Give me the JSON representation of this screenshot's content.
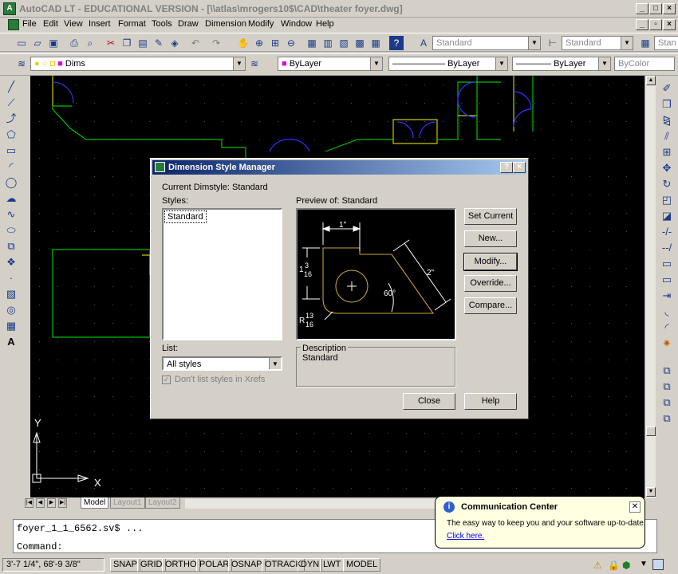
{
  "window": {
    "title": "AutoCAD LT - EDUCATIONAL VERSION - [\\\\atlas\\mrogers10$\\CAD\\theater foyer.dwg]",
    "min": "_",
    "max": "□",
    "close": "×"
  },
  "menu": [
    "File",
    "Edit",
    "View",
    "Insert",
    "Format",
    "Tools",
    "Draw",
    "Dimension",
    "Modify",
    "Window",
    "Help"
  ],
  "toolbar": {
    "text_style": "Standard",
    "dim_style": "Standard",
    "table_style": "Stan",
    "layer": "Dims",
    "color": "ByLayer",
    "linetype": "ByLayer",
    "lineweight": "ByLayer",
    "plotstyle": "ByColor"
  },
  "canvas": {
    "ucs_y": "Y",
    "ucs_x": "X"
  },
  "layout_tabs": [
    "Model",
    "Layout1",
    "Layout2"
  ],
  "command": {
    "history": "foyer_1_1_6562.sv$ ...",
    "prompt": "Command:"
  },
  "status": {
    "coords": "3'-7 1/4\",   68'-9 3/8\"",
    "buttons": [
      "SNAP",
      "GRID",
      "ORTHO",
      "POLAR",
      "OSNAP",
      "OTRACK",
      "DYN",
      "LWT",
      "MODEL"
    ]
  },
  "dialog": {
    "title": "Dimension Style Manager",
    "help": "?",
    "close": "×",
    "current": "Current Dimstyle: Standard",
    "styles_label": "Styles:",
    "styles": [
      "Standard"
    ],
    "preview_label": "Preview of: Standard",
    "list_label": "List:",
    "list_value": "All styles",
    "xrefs_label": "Don't list styles in Xrefs",
    "description_label": "Description",
    "description": "Standard",
    "buttons": {
      "set_current": "Set Current",
      "new": "New...",
      "modify": "Modify...",
      "override": "Override...",
      "compare": "Compare...",
      "close": "Close",
      "help": "Help"
    },
    "preview_dims": {
      "top": "1\"",
      "left_whole": "1",
      "left_num": "3",
      "left_den": "16",
      "right": "2\"",
      "angle": "60°",
      "radius_prefix": "R",
      "radius_num": "13",
      "radius_den": "16"
    }
  },
  "notification": {
    "title": "Communication Center",
    "body": "The easy way to keep you and your software up-to-date.",
    "link": "Click here."
  },
  "colors": {
    "canvas": "#000000",
    "walls": "#00c000",
    "doors": "#3030ff",
    "frames": "#c8c800",
    "title_start": "#0a246a",
    "title_end": "#a6caf0"
  }
}
